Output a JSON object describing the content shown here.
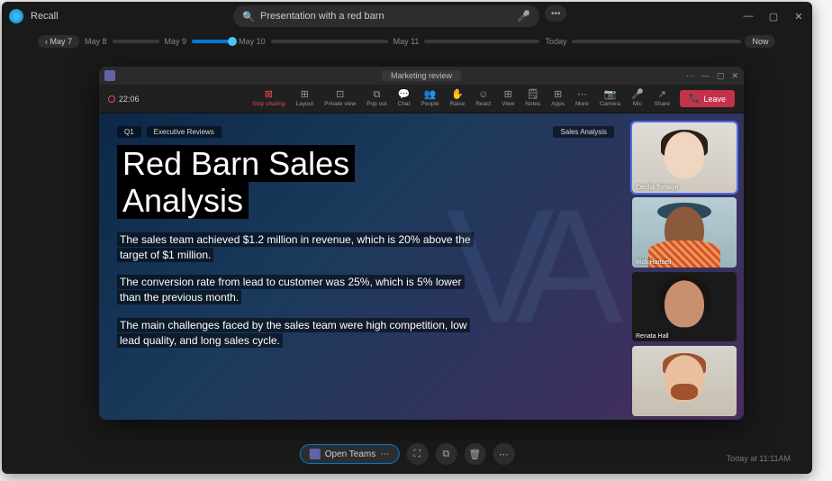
{
  "app": {
    "title": "Recall",
    "search_value": "Presentation with a red barn",
    "search_cursor": "|"
  },
  "titlebar": {
    "min": "—",
    "max": "▢",
    "close": "✕",
    "dots": "•••"
  },
  "timeline": {
    "back_label": "May 7",
    "back_chevron": "‹",
    "labels": [
      "May 8",
      "May 9",
      "May 10",
      "May 11",
      "Today"
    ],
    "now": "Now"
  },
  "teams": {
    "meeting_title": "Marketing review",
    "timer": "22:06",
    "toolbar": [
      {
        "icon": "⊠",
        "label": "Stop sharing",
        "cls": "stop"
      },
      {
        "icon": "⊞",
        "label": "Layout"
      },
      {
        "icon": "⊡",
        "label": "Private view"
      },
      {
        "icon": "⧉",
        "label": "Pop out"
      },
      {
        "icon": "💬",
        "label": "Chat"
      },
      {
        "icon": "👥",
        "label": "People"
      },
      {
        "icon": "✋",
        "label": "Raise"
      },
      {
        "icon": "☺",
        "label": "React"
      },
      {
        "icon": "⊞",
        "label": "View"
      },
      {
        "icon": "🗒",
        "label": "Notes"
      },
      {
        "icon": "⊞",
        "label": "Apps"
      },
      {
        "icon": "⋯",
        "label": "More"
      },
      {
        "icon": "📷",
        "label": "Camera"
      },
      {
        "icon": "🎤",
        "label": "Mic"
      },
      {
        "icon": "↗",
        "label": "Share"
      }
    ],
    "leave": "Leave",
    "win": {
      "dots": "⋯",
      "min": "—",
      "max": "▢",
      "close": "✕"
    }
  },
  "slide": {
    "tags": {
      "q": "Q1",
      "exec": "Executive Reviews",
      "right": "Sales Analysis"
    },
    "title_l1": "Red Barn Sales",
    "title_l2": "Analysis",
    "p1": "The sales team achieved $1.2 million in revenue, which is 20% above the target of $1 million.",
    "p2": "The conversion rate from lead to customer was 25%, which is 5% lower than the previous month.",
    "p3": "The main challenges faced by the sales team were high competition, low lead quality, and long sales cycle."
  },
  "participants": [
    {
      "name": "Cecilia Tomayo"
    },
    {
      "name": "Rick Hartsell"
    },
    {
      "name": "Renata Hall"
    },
    {
      "name": ""
    }
  ],
  "bottom": {
    "open_label": "Open Teams",
    "dots": "⋯",
    "timestamp": "Today at 11:11AM",
    "icons": {
      "crop": "⛶",
      "copy": "⧉",
      "delete": "🗑",
      "more": "⋯"
    }
  }
}
